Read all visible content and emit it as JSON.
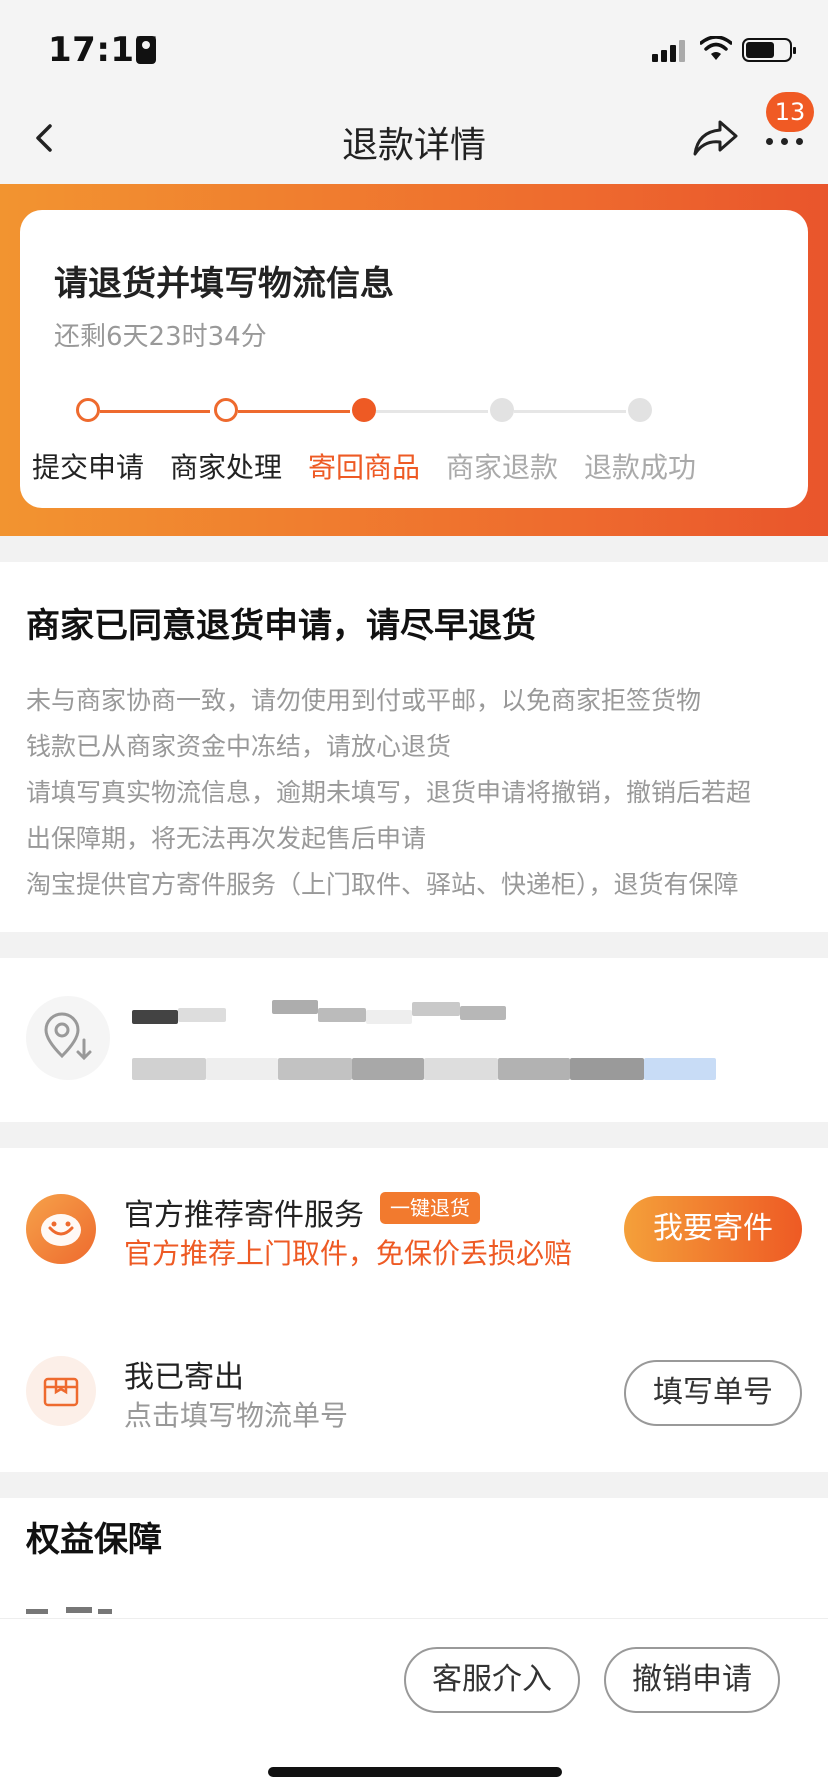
{
  "status": {
    "time": "17:17"
  },
  "nav": {
    "title": "退款详情",
    "badge": "13"
  },
  "progress": {
    "title": "请退货并填写物流信息",
    "subtitle": "还剩6天23时34分",
    "steps": [
      {
        "label": "提交申请",
        "state": "done"
      },
      {
        "label": "商家处理",
        "state": "done"
      },
      {
        "label": "寄回商品",
        "state": "current"
      },
      {
        "label": "商家退款",
        "state": "todo"
      },
      {
        "label": "退款成功",
        "state": "todo"
      }
    ]
  },
  "notice": {
    "title": "商家已同意退货申请，请尽早退货",
    "lines": [
      "未与商家协商一致，请勿使用到付或平邮，以免商家拒签货物",
      "钱款已从商家资金中冻结，请放心退货",
      "请填写真实物流信息，逾期未填写，退货申请将撤销，撤销后若超",
      "出保障期，将无法再次发起售后申请",
      "淘宝提供官方寄件服务（上门取件、驿站、快递柜），退货有保障"
    ]
  },
  "shipping": {
    "service_title": "官方推荐寄件服务",
    "service_tag": "一键退货",
    "service_desc": "官方推荐上门取件，免保价丢损必赔",
    "ship_button": "我要寄件",
    "sent_title": "我已寄出",
    "sent_desc": "点击填写物流单号",
    "fill_button": "填写单号"
  },
  "rights": {
    "title": "权益保障"
  },
  "bottom": {
    "service_button": "客服介入",
    "cancel_button": "撤销申请"
  },
  "colors": {
    "accent": "#ee5a24",
    "banner_start": "#f29430",
    "banner_end": "#e9552c",
    "muted": "#999999"
  },
  "icons": [
    "back-arrow-icon",
    "share-icon",
    "more-icon",
    "location-pin-icon",
    "mascot-icon",
    "package-icon"
  ]
}
